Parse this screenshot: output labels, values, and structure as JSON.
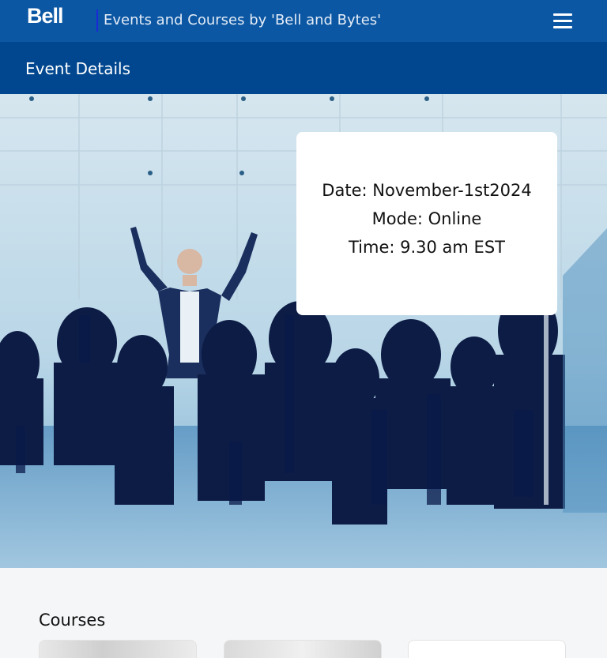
{
  "header": {
    "logo_text": "Bell",
    "site_title": "Events and Courses by 'Bell and Bytes'",
    "menu_icon": "hamburger-menu-icon"
  },
  "subheader": {
    "title": "Event Details"
  },
  "event": {
    "date_text": "Date: November-1st2024",
    "mode_text": "Mode: Online",
    "time_text": "Time: 9.30 am EST"
  },
  "courses": {
    "heading": "Courses"
  },
  "colors": {
    "primary_blue": "#0c57a3",
    "secondary_blue": "#00478f"
  }
}
